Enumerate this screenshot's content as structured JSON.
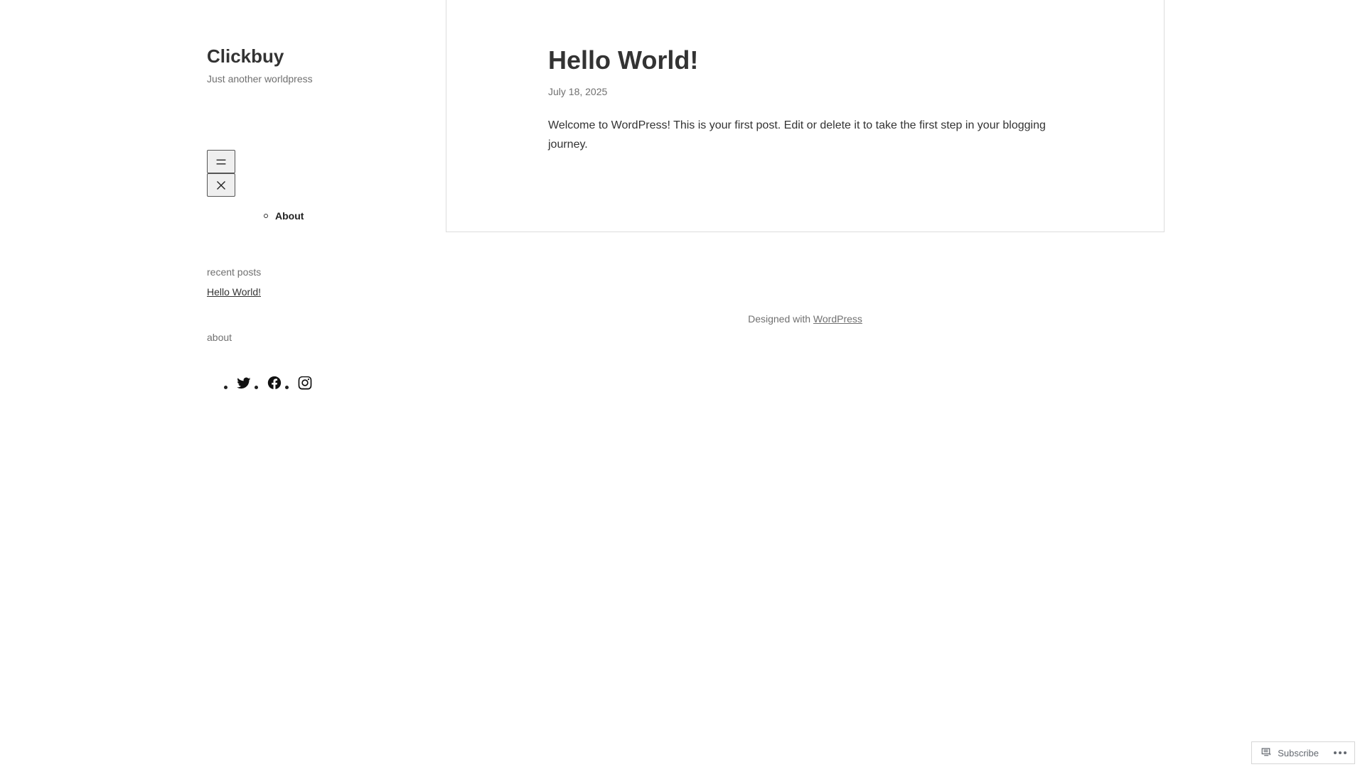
{
  "site": {
    "title": "Clickbuy",
    "tagline": "Just another worldpress"
  },
  "nav": {
    "items": [
      {
        "label": "About"
      }
    ]
  },
  "widgets": {
    "recent_posts_title": "recent posts",
    "recent_posts": [
      {
        "label": "Hello World!"
      }
    ],
    "about_title": "about",
    "social_icons": [
      "twitter-icon",
      "facebook-icon",
      "instagram-icon"
    ]
  },
  "post": {
    "title": "Hello World!",
    "date": "July 18, 2025",
    "content": "Welcome to WordPress! This is your first post. Edit or delete it to take the first step in your blogging journey."
  },
  "footer": {
    "prefix": "Designed with",
    "link_label": "WordPress"
  },
  "subscribe_bar": {
    "subscribe_label": "Subscribe"
  },
  "colors": {
    "text": "#333333",
    "muted": "#707070",
    "border": "#dddddd"
  }
}
